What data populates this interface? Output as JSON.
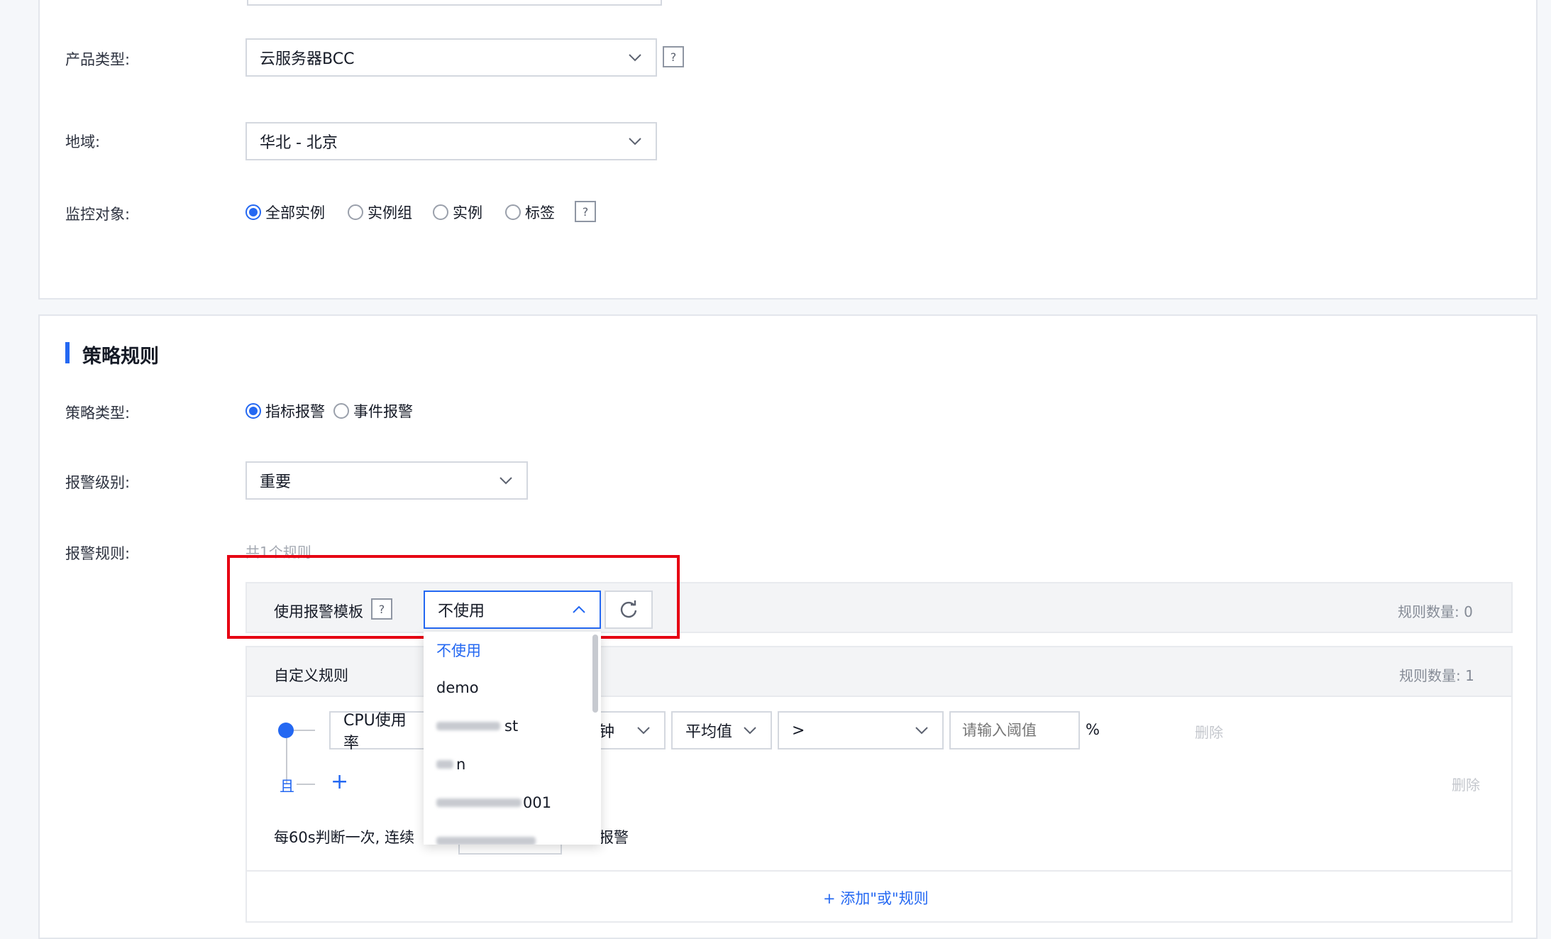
{
  "product_section": {
    "product_type_label": "产品类型:",
    "product_type_value": "云服务器BCC",
    "region_label": "地域:",
    "region_value": "华北 - 北京",
    "monitor_target_label": "监控对象:",
    "monitor_targets": [
      "全部实例",
      "实例组",
      "实例",
      "标签"
    ]
  },
  "strategy_section": {
    "title": "策略规则",
    "type_label": "策略类型:",
    "types": [
      "指标报警",
      "事件报警"
    ],
    "level_label": "报警级别:",
    "level_value": "重要",
    "rule_label": "报警规则:",
    "rule_count_text": "共1个规则",
    "template": {
      "label": "使用报警模板",
      "value": "不使用",
      "count_text": "规则数量: 0",
      "options": [
        "不使用",
        "demo",
        "st",
        "n",
        "001"
      ]
    },
    "custom": {
      "label": "自定义规则",
      "count_text": "规则数量: 1",
      "metric_value": "CPU使用率",
      "period_value": "钟",
      "stat_value": "平均值",
      "op_value": ">",
      "threshold_placeholder": "请输入阈值",
      "unit": "%",
      "delete_label": "删除",
      "and_label": "且",
      "add_icon": "+",
      "delete_label_2": "删除",
      "judge_text_1": "每60s判断一次, 连续",
      "judge_text_2": "报警",
      "add_or_rule": "+ 添加\"或\"规则"
    }
  },
  "colors": {
    "accent": "#2468f2",
    "highlight_red": "#e60012"
  }
}
